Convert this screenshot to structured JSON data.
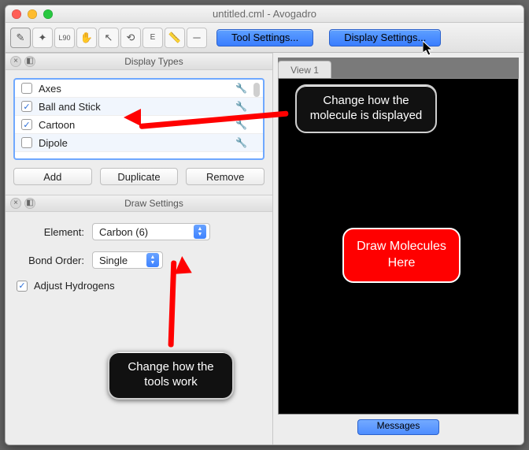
{
  "window": {
    "title": "untitled.cml - Avogadro"
  },
  "toolbar": {
    "tool_settings_label": "Tool Settings...",
    "display_settings_label": "Display Settings...",
    "icons": [
      "pencil",
      "sparkle",
      "L90",
      "hand-grab",
      "pointer",
      "rotate",
      "E-align",
      "ruler",
      "line"
    ]
  },
  "panels": {
    "display_types_title": "Display Types",
    "draw_settings_title": "Draw Settings"
  },
  "display_types": {
    "items": [
      {
        "label": "Axes",
        "checked": false
      },
      {
        "label": "Ball and Stick",
        "checked": true
      },
      {
        "label": "Cartoon",
        "checked": true
      },
      {
        "label": "Dipole",
        "checked": false
      }
    ],
    "buttons": {
      "add": "Add",
      "duplicate": "Duplicate",
      "remove": "Remove"
    }
  },
  "draw_settings": {
    "element_label": "Element:",
    "element_value": "Carbon (6)",
    "bond_order_label": "Bond Order:",
    "bond_order_value": "Single",
    "adjust_hydrogens_label": "Adjust Hydrogens",
    "adjust_hydrogens_checked": true
  },
  "viewer": {
    "tab_label": "View 1",
    "messages_label": "Messages"
  },
  "annotations": {
    "display_callout": "Change how the molecule is displayed",
    "tool_callout": "Change how the tools work",
    "canvas_callout": "Draw Molecules Here"
  }
}
